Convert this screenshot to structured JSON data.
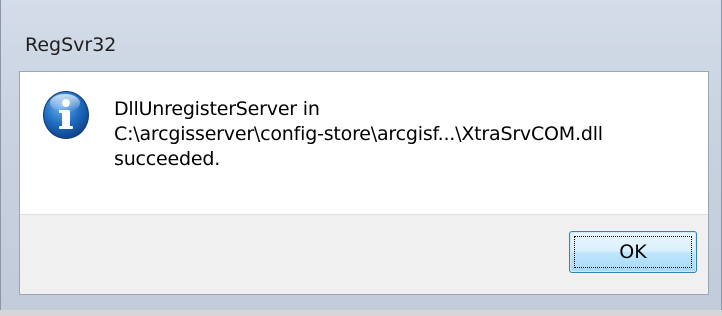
{
  "window": {
    "title": "RegSvr32"
  },
  "message": {
    "icon": "info-icon",
    "lines": [
      "DllUnregisterServer in",
      "C:\\arcgisserver\\config-store\\arcgisf...\\XtraSrvCOM.dll",
      "succeeded."
    ]
  },
  "buttons": {
    "ok_label": "OK"
  },
  "colors": {
    "icon_blue": "#1c5ea8",
    "button_border": "#3c7fb1"
  }
}
